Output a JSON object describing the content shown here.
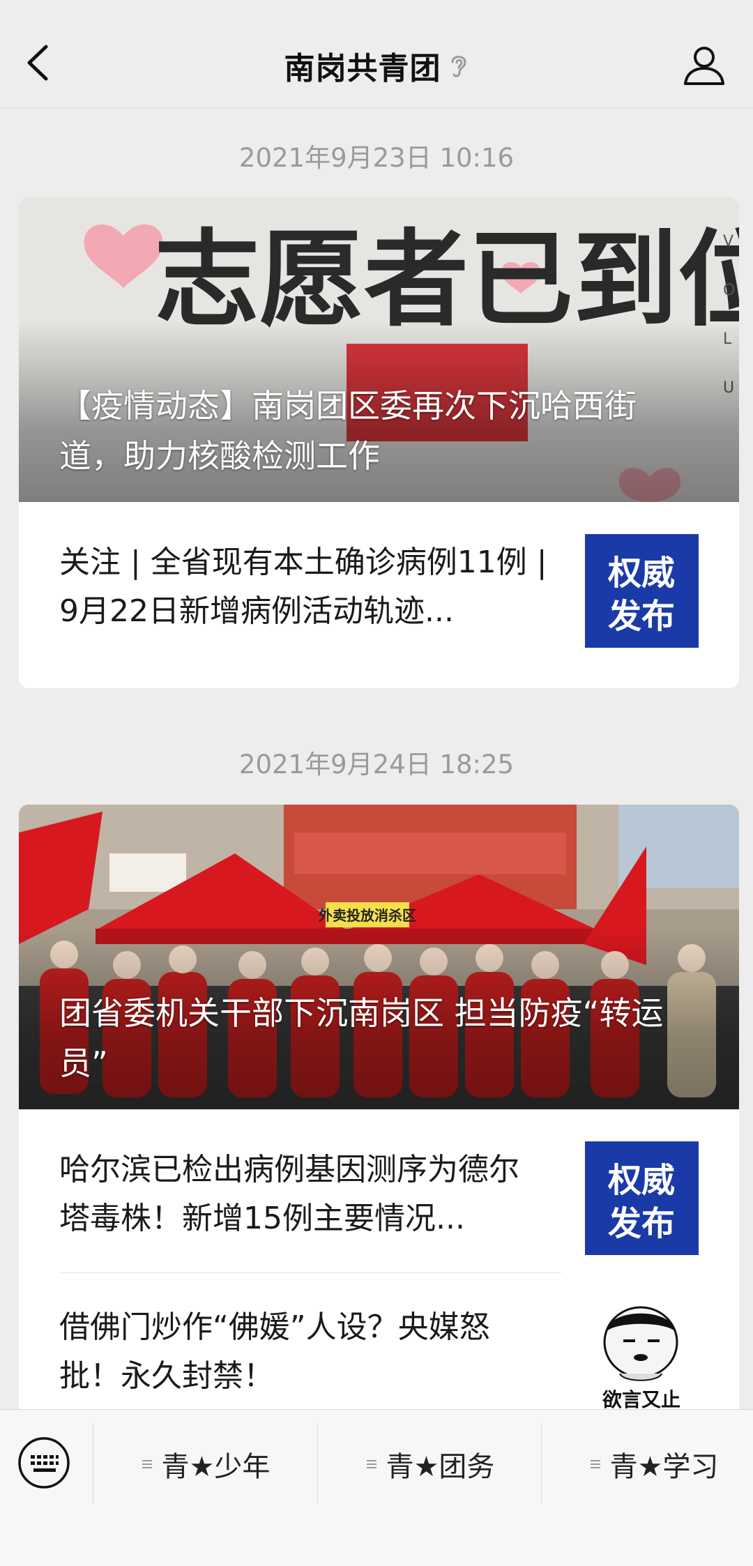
{
  "header": {
    "title": "南岗共青团",
    "back_icon": "chevron-left-icon",
    "profile_icon": "person-icon",
    "title_badge_icon": "ear-icon"
  },
  "feed": [
    {
      "timestamp": "2021年9月23日 10:16",
      "hero": {
        "title": "【疫情动态】南岗团区委再次下沉哈西街道，助力核酸检测工作",
        "image_text": "志愿者已到位"
      },
      "items": [
        {
          "text": "关注 | 全省现有本土确诊病例11例 | 9月22日新增病例活动轨迹...",
          "thumb_text": "权威发布"
        }
      ]
    },
    {
      "timestamp": "2021年9月24日 18:25",
      "hero": {
        "title": "团省委机关干部下沉南岗区 担当防疫“转运员”",
        "image_text": "外卖投放消杀区"
      },
      "items": [
        {
          "text": "哈尔滨已检出病例基因测序为德尔塔毒株！新增15例主要情况...",
          "thumb_text": "权威发布"
        },
        {
          "text": "借佛门炒作“佛媛”人设？央媒怒批！永久封禁！",
          "thumb_text": "欲言又止"
        }
      ]
    }
  ],
  "bottom_menu": [
    {
      "label": "青★少年"
    },
    {
      "label": "青★团务"
    },
    {
      "label": "青★学习"
    }
  ],
  "colors": {
    "background": "#ededed",
    "timestamp": "#9a9a9a",
    "thumb_blue": "#1a3aa8",
    "flag_red": "#d7181f"
  }
}
